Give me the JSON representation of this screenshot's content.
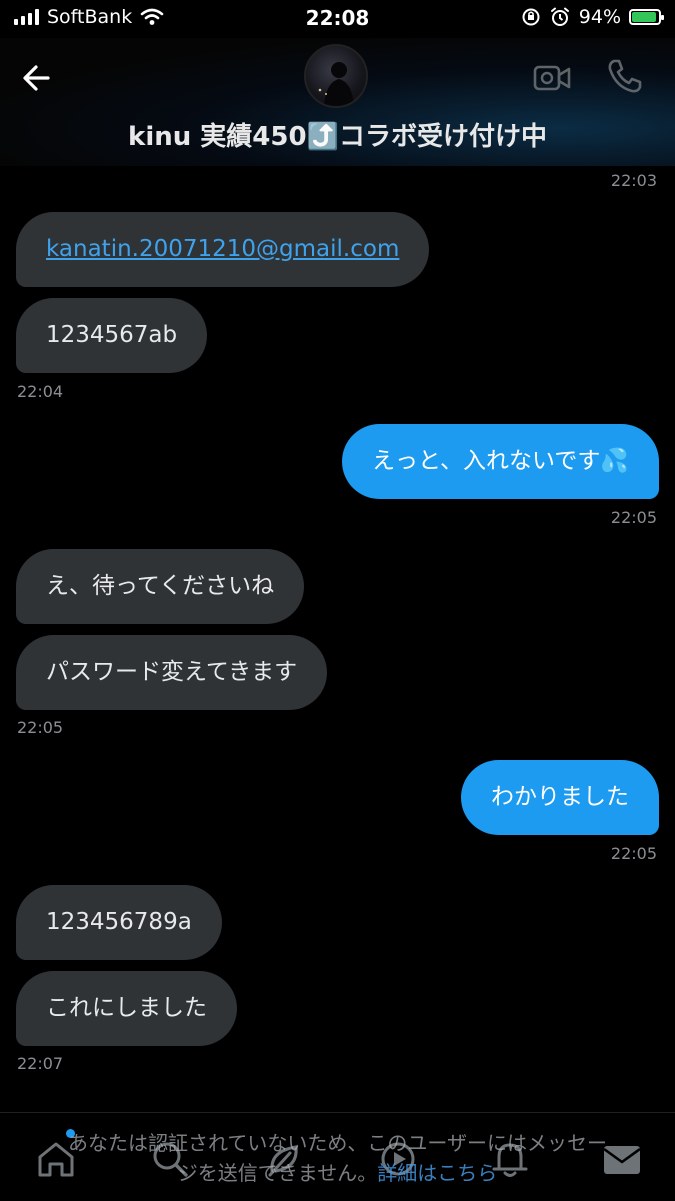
{
  "status": {
    "carrier": "SoftBank",
    "time": "22:08",
    "battery": "94%",
    "battery_level": 0.94,
    "colors": {
      "battery": "#33c759"
    }
  },
  "header": {
    "title": "kinu 実績450⤴️コラボ受け付け中",
    "icons": [
      "back-arrow-icon",
      "avatar",
      "video-camera-icon",
      "phone-icon"
    ]
  },
  "messages": [
    {
      "ts": "22:03"
    },
    {
      "side": "in",
      "text": "kanatin.20071210@gmail.com"
    },
    {
      "side": "in",
      "text": "1234567ab"
    },
    {
      "ts": "22:04"
    },
    {
      "side": "out",
      "text": "えっと、入れないです💦"
    },
    {
      "ts": "22:05"
    },
    {
      "side": "in",
      "text": "え、待ってくださいね"
    },
    {
      "side": "in",
      "text": "パスワード変えてきます"
    },
    {
      "ts": "22:05"
    },
    {
      "side": "out",
      "text": "わかりました"
    },
    {
      "ts": "22:05"
    },
    {
      "side": "in",
      "text": "123456789a"
    },
    {
      "side": "in",
      "text": "これにしました"
    },
    {
      "ts": "22:07"
    }
  ],
  "bubbles": {
    "m1": "kanatin.20071210@gmail.com",
    "m2": "1234567ab",
    "m3": "えっと、入れないです💦",
    "m4": "え、待ってくださいね",
    "m5": "パスワード変えてきます",
    "m6": "わかりました",
    "m7": "123456789a",
    "m8": "これにしました"
  },
  "timestamps": {
    "t0": "22:03",
    "t1": "22:04",
    "t2": "22:05",
    "t3": "22:05",
    "t4": "22:05",
    "t5": "22:07"
  },
  "notice": {
    "line1": "あなたは認証されていないため、このユーザーにはメッセー",
    "line2": "ジを送信できません。",
    "link": "詳細はこちら"
  },
  "nav": [
    "home-icon",
    "search-icon",
    "spaces-icon",
    "video-icon",
    "notifications-icon",
    "messages-icon"
  ],
  "colors": {
    "incoming_bubble": "#2f3336",
    "outgoing_bubble": "#1d9bf0",
    "link": "#3fa2ec"
  }
}
